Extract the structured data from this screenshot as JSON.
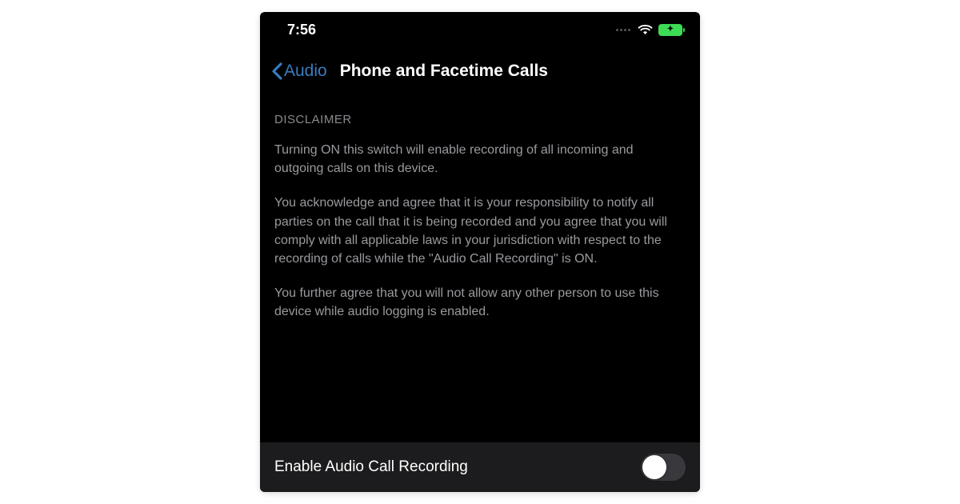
{
  "status": {
    "time": "7:56"
  },
  "nav": {
    "back_label": "Audio",
    "title": "Phone and Facetime Calls"
  },
  "disclaimer": {
    "header": "Disclaimer",
    "p1": "Turning ON this switch will enable recording of all incoming and outgoing calls on this device.",
    "p2": "You acknowledge and agree that it is your responsibility to notify all parties on the call that it is being recorded and you agree that you will comply with all applicable laws in your jurisdiction with respect to the recording of calls while the \"Audio Call Recording\" is ON.",
    "p3": "You further agree that you will not allow any other person to use this device while audio logging is enabled."
  },
  "toggle": {
    "label": "Enable Audio Call Recording",
    "on": false
  }
}
